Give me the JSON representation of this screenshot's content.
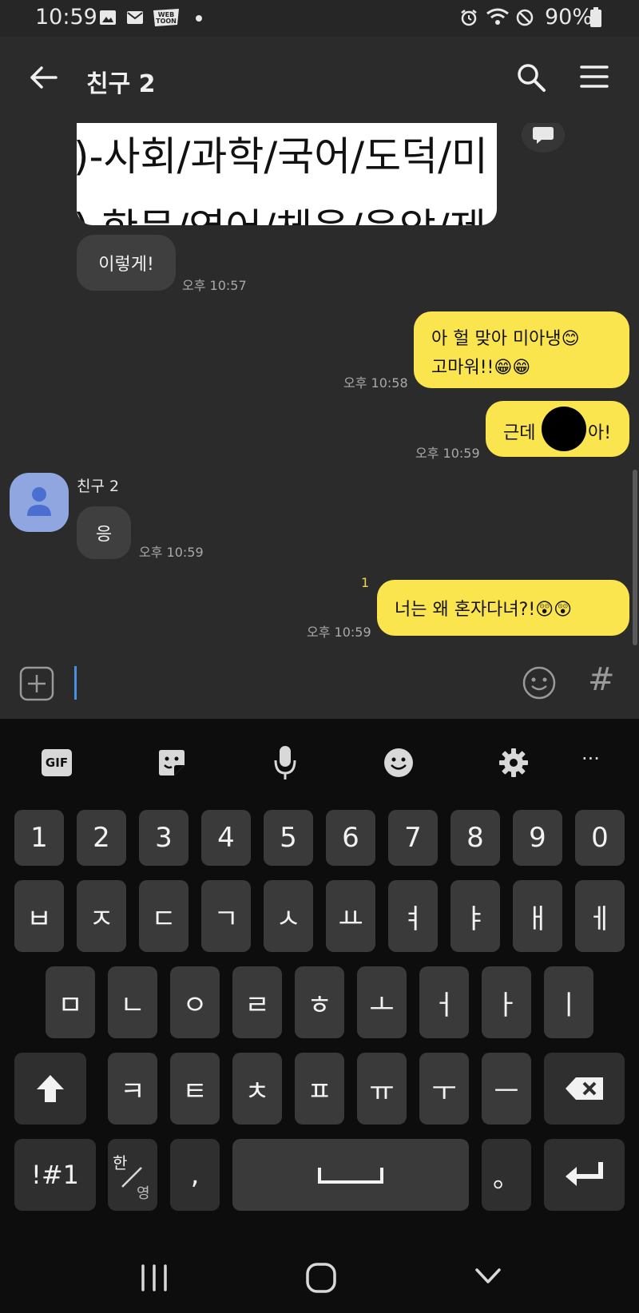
{
  "status_bar": {
    "time": "10:59",
    "battery_percent": "90%",
    "left_icons": [
      "gallery-icon",
      "mail-icon",
      "webtoon-icon",
      "dot-icon"
    ],
    "right_icons": [
      "alarm-icon",
      "wifi-icon",
      "do-not-disturb-icon",
      "battery-icon"
    ],
    "webtoon_label": "WEB TOON"
  },
  "header": {
    "title": "친구 2",
    "back_icon": "back-arrow-icon",
    "search_icon": "search-icon",
    "menu_icon": "menu-icon"
  },
  "chat": {
    "image_message": {
      "line1": ")-사회/과학/국어/도덕/미",
      "line2": ") 한문/영어/체육/음악/제"
    },
    "messages": [
      {
        "side": "in",
        "text": "이렇게!",
        "time": "오후 10:57"
      },
      {
        "side": "out",
        "lines": [
          "아 헐 맞아 미아냉😊",
          "고마워!!😁😁"
        ],
        "time": "오후 10:58"
      },
      {
        "side": "out",
        "text_left": "근데",
        "text_right": "아!",
        "time": "오후 10:59"
      },
      {
        "side": "in",
        "sender": "친구 2",
        "text": "응",
        "time": "오후 10:59"
      },
      {
        "side": "out",
        "text": "너는 왜 혼자다녀?!😲😲",
        "time": "오후 10:59",
        "unread": "1"
      }
    ]
  },
  "input_bar": {
    "add_icon": "plus-square-icon",
    "emoji_icon": "emoji-icon",
    "hashtag_label": "#",
    "value": ""
  },
  "keyboard": {
    "toolbar": {
      "gif_label": "GIF",
      "more_label": "···"
    },
    "row_numbers": [
      "1",
      "2",
      "3",
      "4",
      "5",
      "6",
      "7",
      "8",
      "9",
      "0"
    ],
    "row1": [
      "ㅂ",
      "ㅈ",
      "ㄷ",
      "ㄱ",
      "ㅅ",
      "ㅛ",
      "ㅕ",
      "ㅑ",
      "ㅐ",
      "ㅔ"
    ],
    "row2": [
      "ㅁ",
      "ㄴ",
      "ㅇ",
      "ㄹ",
      "ㅎ",
      "ㅗ",
      "ㅓ",
      "ㅏ",
      "ㅣ"
    ],
    "row3": [
      "ㅋ",
      "ㅌ",
      "ㅊ",
      "ㅍ",
      "ㅠ",
      "ㅜ",
      "ㅡ"
    ],
    "symbols_label": "!#1",
    "lang_top": "한",
    "lang_bottom": "영",
    "comma_label": ",",
    "period_label": "。"
  },
  "colors": {
    "chat_bg": "#2b2b2b",
    "incoming_bubble": "#3f3f3f",
    "outgoing_bubble": "#fbe54e",
    "keyboard_bg": "#0d0d0d",
    "key_bg": "#3a3a3a",
    "avatar_bg": "#8fa6e0",
    "unread_color": "#f2d64c"
  }
}
